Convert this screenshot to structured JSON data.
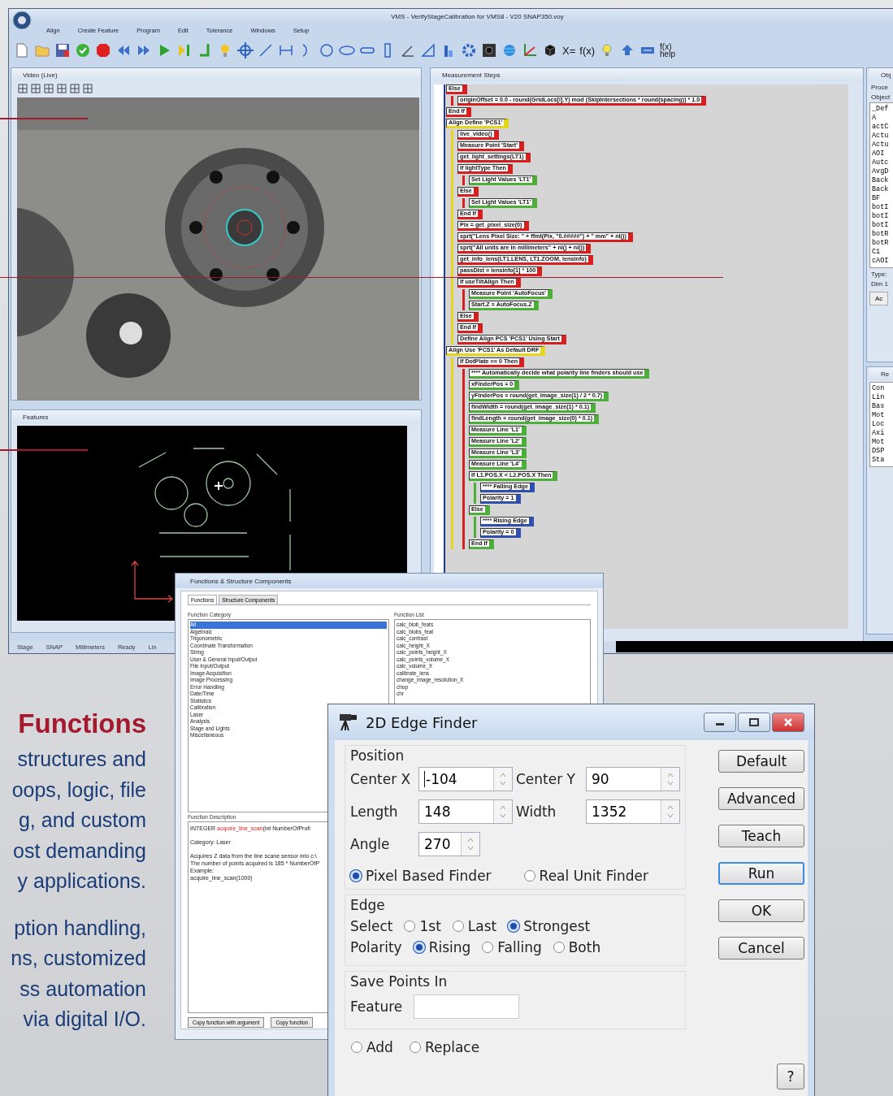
{
  "app_window": {
    "title": "VMS - VerifyStageCalibration for VMS8 - V20 SNAP350.voy",
    "menu": [
      "Align",
      "Create Feature",
      "Program",
      "Edit",
      "Tolerance",
      "Windows",
      "Setup"
    ],
    "toolbar_texts": [
      "X=",
      "f(x)"
    ],
    "help_button": [
      "f(x)",
      "help"
    ],
    "video_panel": {
      "title": "Video (Live)"
    },
    "features_panel": {
      "title": "Features"
    },
    "steps_panel": {
      "title": "Measurement Steps",
      "steps": [
        {
          "text": "Else",
          "color": "#d81e1e",
          "children": [
            {
              "text": "originOffset = 0.0 - round(GridLocs[i].Y) mod (SkipIntersections * round(spacing)) * 1.0",
              "color": "#d81e1e"
            }
          ]
        },
        {
          "text": "End If",
          "color": "#d81e1e"
        },
        {
          "text": "Align Define 'PCS1'",
          "color": "#e3d61c",
          "children": [
            {
              "text": "live_video()",
              "color": "#d81e1e"
            },
            {
              "text": "Measure Point 'Start'",
              "color": "#d81e1e"
            },
            {
              "text": "get_light_settings(LT1)",
              "color": "#d81e1e"
            },
            {
              "text": "If lightType Then",
              "color": "#d81e1e",
              "children": [
                {
                  "text": "Set Light Values 'LT1'",
                  "color": "#4caf3a"
                }
              ]
            },
            {
              "text": "Else",
              "color": "#d81e1e",
              "children": [
                {
                  "text": "Set Light Values 'LT1'",
                  "color": "#4caf3a"
                }
              ]
            },
            {
              "text": "End If",
              "color": "#d81e1e"
            },
            {
              "text": "Pix = get_pixel_size(0)",
              "color": "#d81e1e"
            },
            {
              "text": "sprt(\"Lens Pixel Size: \" + ffmt(Pix, \"0.#####\") + \" mm\" + nl())",
              "color": "#d81e1e"
            },
            {
              "text": "sprt(\"All units are in millimeters\" + nl() + nl())",
              "color": "#d81e1e"
            },
            {
              "text": "get_info_lens(LT1.LENS, LT1.ZOOM, lensinfo)",
              "color": "#d81e1e"
            },
            {
              "text": "passDist = lensinfo[1] * 100",
              "color": "#d81e1e"
            },
            {
              "text": "If useTiltAlign Then",
              "color": "#d81e1e",
              "children": [
                {
                  "text": "Measure Point 'AutoFocus'",
                  "color": "#4caf3a"
                },
                {
                  "text": "Start.Z = AutoFocus.Z",
                  "color": "#4caf3a"
                }
              ]
            },
            {
              "text": "Else",
              "color": "#d81e1e"
            },
            {
              "text": "End If",
              "color": "#d81e1e"
            },
            {
              "text": "Define Align PCS 'PCS1' Using Start",
              "color": "#d81e1e"
            }
          ]
        },
        {
          "text": "Align Use 'PCS1' As Default DRF",
          "color": "#e3d61c",
          "children": [
            {
              "text": "If DotPlate == 0 Then",
              "color": "#d81e1e",
              "children": [
                {
                  "text": "**** Automatically decide what polarity line finders should use",
                  "color": "#4caf3a"
                },
                {
                  "text": "xFinderPos = 0",
                  "color": "#4caf3a"
                },
                {
                  "text": "yFinderPos = round(get_image_size(1) / 2 * 0.7)",
                  "color": "#4caf3a"
                },
                {
                  "text": "findWidth = round(get_image_size(1) * 0.1)",
                  "color": "#4caf3a"
                },
                {
                  "text": "findLength = round(get_image_size(0) * 0.1)",
                  "color": "#4caf3a"
                },
                {
                  "text": "Measure Line 'L1'",
                  "color": "#4caf3a"
                },
                {
                  "text": "Measure Line 'L2'",
                  "color": "#4caf3a"
                },
                {
                  "text": "Measure Line 'L3'",
                  "color": "#4caf3a"
                },
                {
                  "text": "Measure Line 'L4'",
                  "color": "#4caf3a"
                },
                {
                  "text": "If L1.POS.X < L2.POS.X Then",
                  "color": "#4caf3a",
                  "children": [
                    {
                      "text": "**** Falling Edge",
                      "color": "#2e4fb0"
                    },
                    {
                      "text": "Polarity = 1",
                      "color": "#2e4fb0"
                    }
                  ]
                },
                {
                  "text": "Else",
                  "color": "#4caf3a",
                  "children": [
                    {
                      "text": "**** Rising Edge",
                      "color": "#2e4fb0"
                    },
                    {
                      "text": "Polarity = 0",
                      "color": "#2e4fb0"
                    }
                  ]
                },
                {
                  "text": "End If",
                  "color": "#4caf3a"
                }
              ]
            }
          ]
        }
      ]
    },
    "object_panel": {
      "title": "Obj",
      "labels": [
        "Proce",
        "Object"
      ],
      "list_header": "_Def",
      "items": [
        "A",
        "actC",
        "Actu",
        "Actu",
        "AOI",
        "Autc",
        "AvgD",
        "Back",
        "Back",
        "BF",
        "botI",
        "botI",
        "botI",
        "botR",
        "botR",
        "C1",
        "cAOI"
      ],
      "fields": [
        "Type:",
        "Dim 1"
      ],
      "button": "Ac"
    },
    "results_panel": {
      "title": "Re",
      "items": [
        "Con",
        "Lin",
        "Bas",
        "Mot",
        "Loc",
        "Axi",
        "Mot",
        "DSP",
        "Sta"
      ]
    },
    "status_bar": [
      "Stage",
      "SNAP",
      "Millimeters",
      "Ready",
      "Lin"
    ]
  },
  "functions_dialog": {
    "title": "Functions & Structure Components",
    "tabs": [
      {
        "label": "Functions",
        "selected": true
      },
      {
        "label": "Structure Components",
        "selected": false
      }
    ],
    "category_label": "Function Category",
    "categories": [
      {
        "label": "All",
        "selected": true
      },
      {
        "label": "Algebraic",
        "selected": false
      },
      {
        "label": "Trigonometric",
        "selected": false
      },
      {
        "label": "Coordinate Transformation",
        "selected": false
      },
      {
        "label": "String",
        "selected": false
      },
      {
        "label": "User & General Input/Output",
        "selected": false
      },
      {
        "label": "File Input/Output",
        "selected": false
      },
      {
        "label": "Image Acquisition",
        "selected": false
      },
      {
        "label": "Image Processing",
        "selected": false
      },
      {
        "label": "Error Handling",
        "selected": false
      },
      {
        "label": "Date/Time",
        "selected": false
      },
      {
        "label": "Statistics",
        "selected": false
      },
      {
        "label": "Calibration",
        "selected": false
      },
      {
        "label": "Laser",
        "selected": false
      },
      {
        "label": "Analysis",
        "selected": false
      },
      {
        "label": "Stage and Lights",
        "selected": false
      },
      {
        "label": "Miscellaneous",
        "selected": false
      }
    ],
    "list_label": "Function List",
    "functions": [
      "calc_blob_feats",
      "calc_blobs_feat",
      "calc_contrast",
      "calc_height_X",
      "calc_points_height_X",
      "calc_points_volume_X",
      "calc_volume_X",
      "calibrate_lens",
      "change_image_resolution_X",
      "chop",
      "chr"
    ],
    "description_label": "Function Description",
    "signature": {
      "type": "INTEGER ",
      "name": "acquire_line_scan",
      "args": "(int NumberOfProfi"
    },
    "description": [
      "Category: Laser",
      "Acquires Z data from the line scane sensor into c:\\",
      "The number of points acquired is 185 * NumberOfP",
      "Example:",
      "acquire_line_scan(1000)"
    ],
    "buttons": [
      "Copy function with argument",
      "Copy function"
    ]
  },
  "edge_finder": {
    "title": "2D Edge Finder",
    "position_title": "Position",
    "fields": [
      {
        "label": "Center X",
        "value": "-104"
      },
      {
        "label": "Center Y",
        "value": "90"
      },
      {
        "label": "Length",
        "value": "148"
      },
      {
        "label": "Width",
        "value": "1352"
      },
      {
        "label": "Angle",
        "value": "270"
      }
    ],
    "finder_type": [
      {
        "label": "Pixel Based Finder",
        "selected": true
      },
      {
        "label": "Real Unit Finder",
        "selected": false
      }
    ],
    "edge_title": "Edge",
    "select_label": "Select",
    "select": [
      {
        "label": "1st",
        "selected": false
      },
      {
        "label": "Last",
        "selected": false
      },
      {
        "label": "Strongest",
        "selected": true
      }
    ],
    "polarity_label": "Polarity",
    "polarity": [
      {
        "label": "Rising",
        "selected": true
      },
      {
        "label": "Falling",
        "selected": false
      },
      {
        "label": "Both",
        "selected": false
      }
    ],
    "save_title": "Save Points In",
    "feature_label": "Feature",
    "save_mode": [
      {
        "label": "Add",
        "selected": false
      },
      {
        "label": "Replace",
        "selected": false
      }
    ],
    "buttons": [
      {
        "label": "Default",
        "focused": false
      },
      {
        "label": "Advanced",
        "focused": false
      },
      {
        "label": "Teach",
        "focused": false
      },
      {
        "label": "Run",
        "focused": true
      },
      {
        "label": "OK",
        "focused": false
      },
      {
        "label": "Cancel",
        "focused": false
      }
    ],
    "help_button": "?"
  },
  "brochure": {
    "heading": "Functions",
    "paragraphs": [
      [
        "structures and",
        "oops, logic, file",
        "g, and custom",
        "ost demanding",
        "y applications."
      ],
      [
        "ption handling,",
        "ns, customized",
        "ss automation",
        "via digital I/O."
      ]
    ]
  }
}
